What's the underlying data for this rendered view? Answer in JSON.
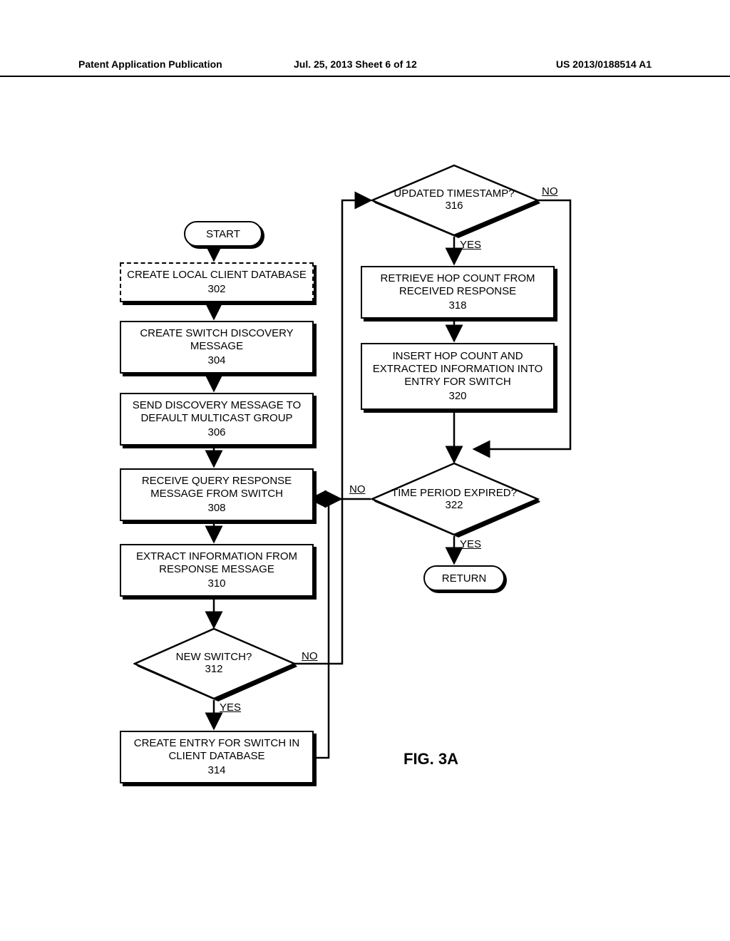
{
  "header": {
    "left": "Patent Application Publication",
    "middle": "Jul. 25, 2013  Sheet 6 of 12",
    "right": "US 2013/0188514 A1"
  },
  "figure_label": "FIG. 3A",
  "terminators": {
    "start": "START",
    "return": "RETURN"
  },
  "nodes": {
    "n302": {
      "text": "CREATE LOCAL CLIENT DATABASE",
      "num": "302"
    },
    "n304": {
      "text": "CREATE SWITCH DISCOVERY MESSAGE",
      "num": "304"
    },
    "n306": {
      "text": "SEND DISCOVERY MESSAGE TO DEFAULT MULTICAST GROUP",
      "num": "306"
    },
    "n308": {
      "text": "RECEIVE QUERY RESPONSE MESSAGE FROM SWITCH",
      "num": "308"
    },
    "n310": {
      "text": "EXTRACT INFORMATION FROM RESPONSE MESSAGE",
      "num": "310"
    },
    "n312": {
      "text": "NEW SWITCH?",
      "num": "312"
    },
    "n314": {
      "text": "CREATE ENTRY FOR SWITCH IN CLIENT DATABASE",
      "num": "314"
    },
    "n316": {
      "text": "UPDATED TIMESTAMP?",
      "num": "316"
    },
    "n318": {
      "text": "RETRIEVE HOP COUNT FROM RECEIVED RESPONSE",
      "num": "318"
    },
    "n320": {
      "text": "INSERT HOP COUNT AND EXTRACTED INFORMATION INTO ENTRY FOR SWITCH",
      "num": "320"
    },
    "n322": {
      "text": "TIME PERIOD EXPIRED?",
      "num": "322"
    }
  },
  "edge_labels": {
    "yes": "YES",
    "no": "NO"
  }
}
